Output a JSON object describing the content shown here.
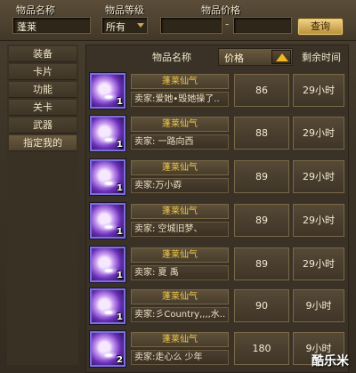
{
  "search": {
    "name_label": "物品名称",
    "name_value": "蓬莱",
    "level_label": "物品等级",
    "level_value": "所有",
    "price_label": "物品价格",
    "price_min": "",
    "price_max": "",
    "price_dash": "-",
    "query_label": "查询"
  },
  "sidebar": {
    "items": [
      {
        "label": "装备"
      },
      {
        "label": "卡片"
      },
      {
        "label": "功能"
      },
      {
        "label": "关卡"
      },
      {
        "label": "武器"
      },
      {
        "label": "指定我的"
      }
    ]
  },
  "columns": {
    "name": "物品名称",
    "price": "价格",
    "time": "剩余时间"
  },
  "rows": [
    {
      "name": "蓬莱仙气",
      "seller": "卖家:爱她•毁她操了..",
      "price": "86",
      "time": "29小时",
      "count": "1"
    },
    {
      "name": "蓬莱仙气",
      "seller": "卖家:      一路向西",
      "price": "88",
      "time": "29小时",
      "count": "1"
    },
    {
      "name": "蓬莱仙气",
      "seller": "卖家:万小孬",
      "price": "89",
      "time": "29小时",
      "count": "1"
    },
    {
      "name": "蓬莱仙气",
      "seller": "卖家:      空城旧梦、",
      "price": "89",
      "time": "29小时",
      "count": "1"
    },
    {
      "name": "蓬莱仙气",
      "seller": "卖家:   夏 禹",
      "price": "89",
      "time": "29小时",
      "count": "1"
    },
    {
      "name": "蓬莱仙气",
      "seller": "卖家:彡Country,,,,水..",
      "price": "90",
      "time": "9小时",
      "count": "1"
    },
    {
      "name": "蓬莱仙气",
      "seller": "卖家:走心么  少年",
      "price": "180",
      "time": "9小时",
      "count": "2"
    }
  ],
  "watermark": "酷乐米",
  "colors": {
    "item_name": "#f2c94a",
    "sort_arrow": "#f0b828",
    "icon_border": "#7b6fd8"
  },
  "icons": {
    "item": "purple-swirl-item-icon",
    "sort": "triangle-up-icon",
    "dropdown": "chevron-down-icon"
  }
}
